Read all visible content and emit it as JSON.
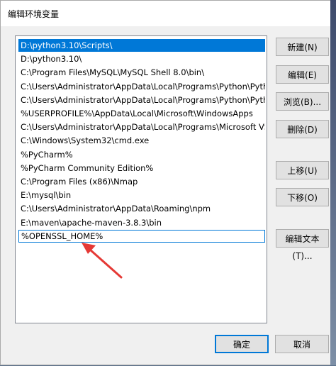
{
  "window": {
    "title": "编辑环境变量"
  },
  "paths": [
    "D:\\python3.10\\Scripts\\",
    "D:\\python3.10\\",
    "C:\\Program Files\\MySQL\\MySQL Shell 8.0\\bin\\",
    "C:\\Users\\Administrator\\AppData\\Local\\Programs\\Python\\Pytho...",
    "C:\\Users\\Administrator\\AppData\\Local\\Programs\\Python\\Pytho...",
    "%USERPROFILE%\\AppData\\Local\\Microsoft\\WindowsApps",
    "C:\\Users\\Administrator\\AppData\\Local\\Programs\\Microsoft VS ...",
    "C:\\Windows\\System32\\cmd.exe",
    "%PyCharm%",
    "%PyCharm Community Edition%",
    "C:\\Program Files (x86)\\Nmap",
    "E:\\mysql\\bin",
    "C:\\Users\\Administrator\\AppData\\Roaming\\npm",
    "E:\\maven\\apache-maven-3.8.3\\bin",
    "%OPENSSL_HOME%"
  ],
  "selected_index": 0,
  "editing_index": 14,
  "buttons": {
    "new": "新建(N)",
    "edit": "编辑(E)",
    "browse": "浏览(B)...",
    "delete": "删除(D)",
    "move_up": "上移(U)",
    "move_down": "下移(O)",
    "edit_text": "编辑文本(T)...",
    "ok": "确定",
    "cancel": "取消"
  },
  "colors": {
    "selection": "#0078d7",
    "arrow": "#e53935"
  }
}
